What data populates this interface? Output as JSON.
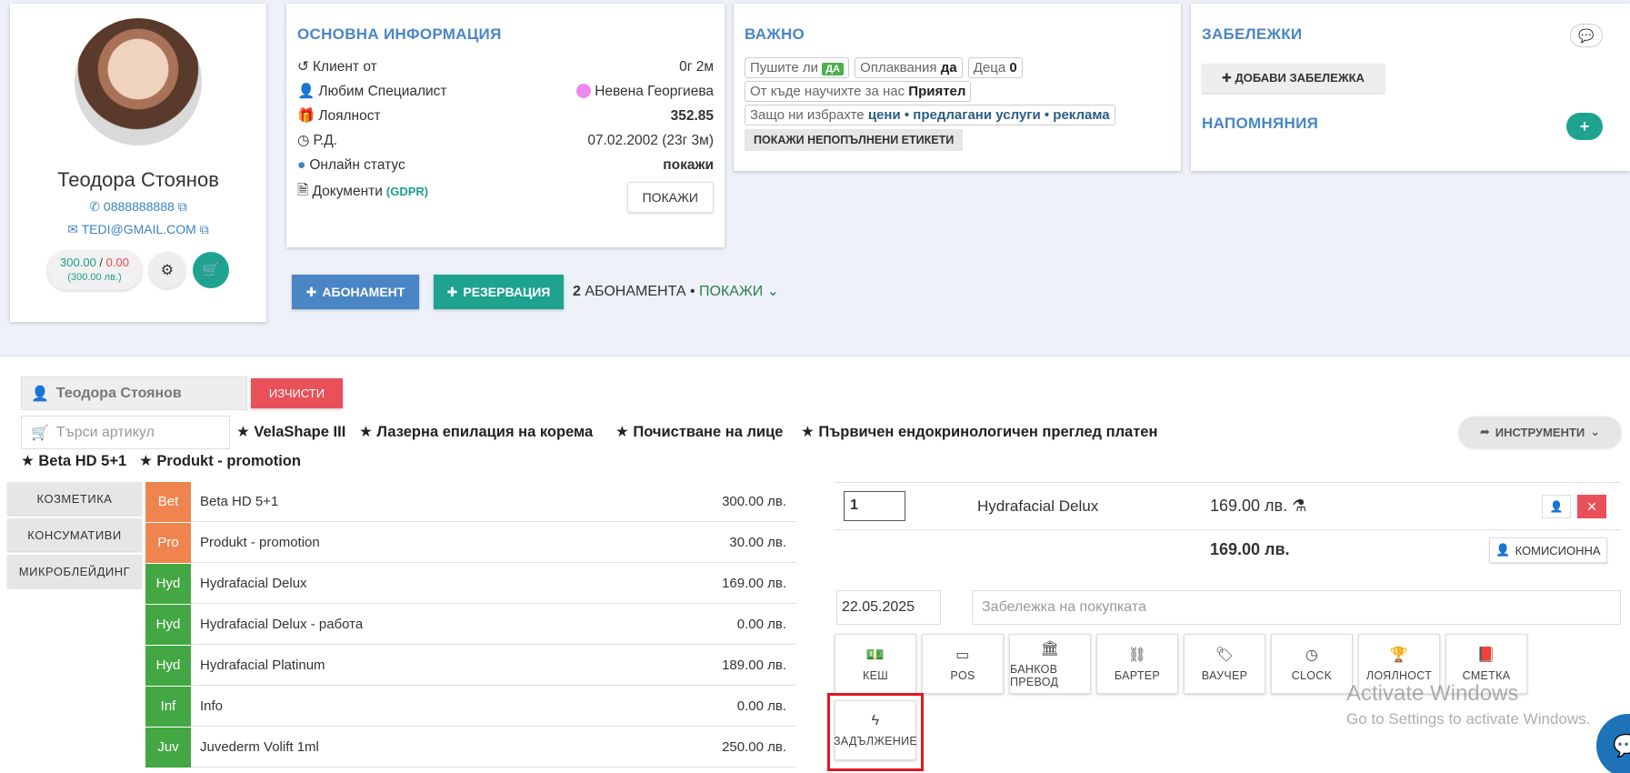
{
  "profile": {
    "name": "Теодора Стоянов",
    "phone": "0888888888",
    "email": "TEDI@GMAIL.COM",
    "balance_pos": "300.00",
    "balance_sep": " / ",
    "balance_neg": "0.00",
    "balance_sub": "(300.00 лв.)"
  },
  "main_info": {
    "title": "ОСНОВНА ИНФОРМАЦИЯ",
    "rows": [
      {
        "label": "Клиент от",
        "value": "0г 2м"
      },
      {
        "label": "Любим Специалист",
        "value": "Невена Георгиева"
      },
      {
        "label": "Лоялност",
        "value": "352.85"
      },
      {
        "label": "Р.Д.",
        "value": "07.02.2002 (23г 3м)"
      },
      {
        "label": "Онлайн статус",
        "value": "покажи"
      },
      {
        "label": "Документи",
        "value": ""
      }
    ],
    "gdpr": "(GDPR)",
    "show_btn": "ПОКАЖИ"
  },
  "important": {
    "title": "ВАЖНО",
    "smoke_label": "Пушите ли",
    "smoke_value": "ДА",
    "swim_label": "Оплаквания",
    "swim_value": "да",
    "kids_label": "Деца",
    "kids_value": "0",
    "heard_label": "От къде научихте за нас",
    "heard_value": "Приятел",
    "why_label": "Защо ни избрахте",
    "why_value": "цени • предлагани услуги • реклама",
    "unfilled_btn": "ПОКАЖИ НЕПОПЪЛНЕНИ ЕТИКЕТИ"
  },
  "notes": {
    "title": "ЗАБЕЛЕЖКИ",
    "add_btn": "ДОБАВИ ЗАБЕЛЕЖКА",
    "reminders_title": "НАПОМНЯНИЯ"
  },
  "actions": {
    "subscription": "АБОНАМЕНТ",
    "reservation": "РЕЗЕРВАЦИЯ",
    "sub_count": "2",
    "sub_text": "АБОНАМЕНТА •",
    "sub_show": "ПОКАЖИ"
  },
  "sale": {
    "client": "Теодора Стоянов",
    "clear_btn": "ИЗЧИСТИ",
    "search_placeholder": "Търси артикул",
    "tools_btn": "ИНСТРУМЕНТИ",
    "favorites": [
      "VelaShape III",
      "Лазерна епилация на корема",
      "Почистване на лице",
      "Първичен ендокринологичен преглед платен",
      "Beta HD 5+1",
      "Produkt - promotion"
    ],
    "categories": [
      "КОЗМЕТИКА",
      "КОНСУМАТИВИ",
      "МИКРОБЛЕЙДИНГ"
    ],
    "products": [
      {
        "code": "Bet",
        "name": "Beta HD 5+1",
        "price": "300.00 лв.",
        "color": "#f0844f"
      },
      {
        "code": "Pro",
        "name": "Produkt - promotion",
        "price": "30.00 лв.",
        "color": "#f0844f"
      },
      {
        "code": "Hyd",
        "name": "Hydrafacial Delux",
        "price": "169.00 лв.",
        "color": "#43a843"
      },
      {
        "code": "Hyd",
        "name": "Hydrafacial Delux - работа",
        "price": "0.00 лв.",
        "color": "#43a843"
      },
      {
        "code": "Hyd",
        "name": "Hydrafacial Platinum",
        "price": "189.00 лв.",
        "color": "#43a843"
      },
      {
        "code": "Inf",
        "name": "Info",
        "price": "0.00 лв.",
        "color": "#43a843"
      },
      {
        "code": "Juv",
        "name": "Juvederm Volift 1ml",
        "price": "250.00 лв.",
        "color": "#43a843"
      }
    ],
    "cart": {
      "qty": "1",
      "item": "Hydrafacial Delux",
      "price": "169.00 лв.",
      "total": "169.00 лв.",
      "commission_btn": "КОМИСИОННА",
      "date": "22.05.2025",
      "note_placeholder": "Забележка на покупката"
    },
    "payments": [
      "КЕШ",
      "POS",
      "БАНКОВ ПРЕВОД",
      "БАРТЕР",
      "ВАУЧЕР",
      "CLOCK",
      "ЛОЯЛНОСТ",
      "СМЕТКА"
    ],
    "debt_btn": "ЗАДЪЛЖЕНИЕ"
  },
  "watermark": {
    "line1": "Activate Windows",
    "line2": "Go to Settings to activate Windows."
  }
}
